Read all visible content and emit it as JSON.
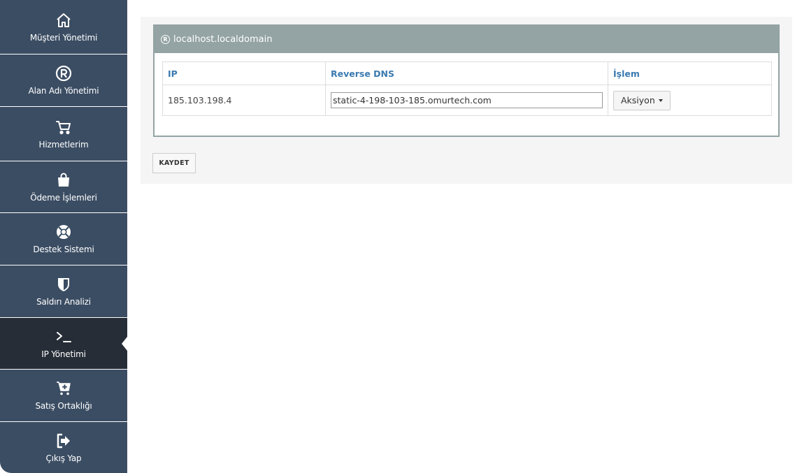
{
  "sidebar": {
    "items": [
      {
        "label": "Müşteri Yönetimi",
        "icon": "home-icon"
      },
      {
        "label": "Alan Adı Yönetimi",
        "icon": "registered-icon"
      },
      {
        "label": "Hizmetlerim",
        "icon": "cart-icon"
      },
      {
        "label": "Ödeme İşlemleri",
        "icon": "shopping-bag-icon"
      },
      {
        "label": "Destek Sistemi",
        "icon": "lifebuoy-icon"
      },
      {
        "label": "Saldırı Analizi",
        "icon": "shield-icon"
      },
      {
        "label": "IP Yönetimi",
        "icon": "terminal-icon",
        "active": true
      },
      {
        "label": "Satış Ortaklığı",
        "icon": "cart-plus-icon"
      },
      {
        "label": "Çıkış Yap",
        "icon": "sign-out-icon"
      }
    ]
  },
  "panel": {
    "title": "localhost.localdomain",
    "icon": "registered-icon",
    "table": {
      "headers": {
        "ip": "IP",
        "reverse_dns": "Reverse DNS",
        "action": "İşlem"
      },
      "rows": [
        {
          "ip": "185.103.198.4",
          "reverse_dns": "static-4-198-103-185.omurtech.com",
          "action_label": "Aksiyon"
        }
      ]
    }
  },
  "save_label": "KAYDET",
  "colors": {
    "sidebar_bg": "#3b4d63",
    "sidebar_active": "#262d37",
    "panel_header": "#94a3a3",
    "header_text": "#3a7ab0"
  }
}
